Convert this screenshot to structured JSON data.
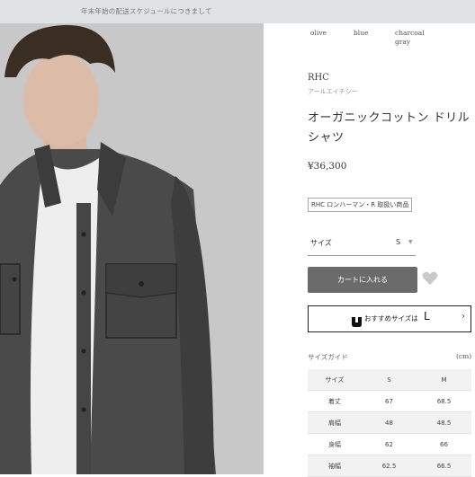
{
  "notice": {
    "text": "年末年始の配送スケジュールにつきまして"
  },
  "colors": {
    "options": [
      {
        "label": "olive"
      },
      {
        "label": "blue"
      },
      {
        "label": "charcoal gray"
      }
    ]
  },
  "product": {
    "brand": "RHC",
    "brand_kana": "アールエイチシー",
    "title": "オーガニックコットン ドリルシャツ",
    "price": "¥36,300",
    "tag": "RHC ロンハーマン・R 取扱い商品"
  },
  "size": {
    "label": "サイズ",
    "selected": "S"
  },
  "cart": {
    "label": "カートに入れる"
  },
  "recommend": {
    "text": "おすすめサイズは",
    "size": "L"
  },
  "size_guide": {
    "title": "サイズガイド",
    "unit": "(cm)",
    "headers": [
      "サイズ",
      "S",
      "M"
    ],
    "rows": [
      [
        "着丈",
        "67",
        "68.5"
      ],
      [
        "肩幅",
        "48",
        "48.5"
      ],
      [
        "身幅",
        "62",
        "66"
      ],
      [
        "袖幅",
        "62.5",
        "66.5"
      ]
    ]
  },
  "theme": {
    "button": "#6b6b6b",
    "notice_bg": "#dfe3e6"
  }
}
